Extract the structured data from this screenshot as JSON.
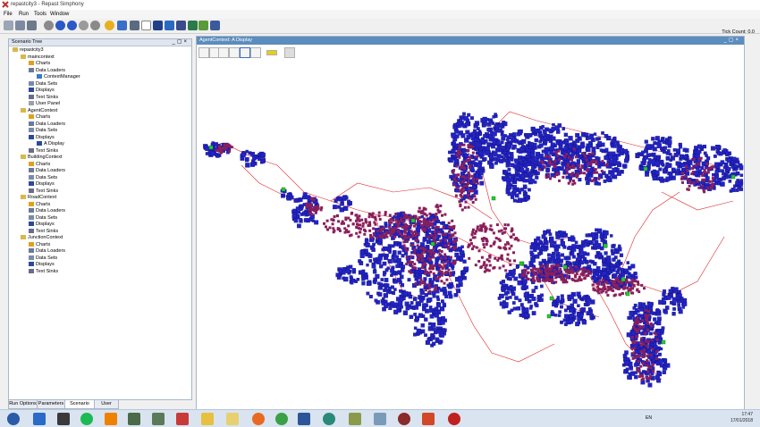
{
  "window": {
    "title": "repastcity3 - Repast Simphony"
  },
  "menu": [
    "File",
    "Run",
    "Tools",
    "Window"
  ],
  "tick_count": "Tick Count: 0.0",
  "left_panel": {
    "title": "Scenario Tree",
    "tree": [
      {
        "label": "repastcity3",
        "level": 0,
        "icon": "folder"
      },
      {
        "label": "maincontext",
        "level": 1,
        "icon": "folder"
      },
      {
        "label": "Charts",
        "level": 2,
        "icon": "chart"
      },
      {
        "label": "Data Loaders",
        "level": 2,
        "icon": "loader"
      },
      {
        "label": "ContextManager",
        "level": 3,
        "icon": "loaderitem"
      },
      {
        "label": "Data Sets",
        "level": 2,
        "icon": "dataset"
      },
      {
        "label": "Displays",
        "level": 2,
        "icon": "display"
      },
      {
        "label": "Text Sinks",
        "level": 2,
        "icon": "sink"
      },
      {
        "label": "User Panel",
        "level": 2,
        "icon": "panel"
      },
      {
        "label": "AgentContext",
        "level": 1,
        "icon": "folder"
      },
      {
        "label": "Charts",
        "level": 2,
        "icon": "chart"
      },
      {
        "label": "Data Loaders",
        "level": 2,
        "icon": "loader"
      },
      {
        "label": "Data Sets",
        "level": 2,
        "icon": "dataset"
      },
      {
        "label": "Displays",
        "level": 2,
        "icon": "display"
      },
      {
        "label": "A Display",
        "level": 3,
        "icon": "display"
      },
      {
        "label": "Text Sinks",
        "level": 2,
        "icon": "sink"
      },
      {
        "label": "BuildingContext",
        "level": 1,
        "icon": "folder"
      },
      {
        "label": "Charts",
        "level": 2,
        "icon": "chart"
      },
      {
        "label": "Data Loaders",
        "level": 2,
        "icon": "loader"
      },
      {
        "label": "Data Sets",
        "level": 2,
        "icon": "dataset"
      },
      {
        "label": "Displays",
        "level": 2,
        "icon": "display"
      },
      {
        "label": "Text Sinks",
        "level": 2,
        "icon": "sink"
      },
      {
        "label": "RoadContext",
        "level": 1,
        "icon": "folder"
      },
      {
        "label": "Charts",
        "level": 2,
        "icon": "chart"
      },
      {
        "label": "Data Loaders",
        "level": 2,
        "icon": "loader"
      },
      {
        "label": "Data Sets",
        "level": 2,
        "icon": "dataset"
      },
      {
        "label": "Displays",
        "level": 2,
        "icon": "display"
      },
      {
        "label": "Text Sinks",
        "level": 2,
        "icon": "sink"
      },
      {
        "label": "JunctionContext",
        "level": 1,
        "icon": "folder"
      },
      {
        "label": "Charts",
        "level": 2,
        "icon": "chart"
      },
      {
        "label": "Data Loaders",
        "level": 2,
        "icon": "loader"
      },
      {
        "label": "Data Sets",
        "level": 2,
        "icon": "dataset"
      },
      {
        "label": "Displays",
        "level": 2,
        "icon": "display"
      },
      {
        "label": "Text Sinks",
        "level": 2,
        "icon": "sink"
      }
    ],
    "tabs": [
      "Run Options",
      "Parameters",
      "Scenario Tree",
      "User Panel"
    ],
    "active_tab": "Scenario Tree"
  },
  "display_panel": {
    "title": "AgentContext: A Display",
    "tools": [
      "save-icon",
      "refresh-icon",
      "home-icon",
      "zoom-icon",
      "zoom-box-icon",
      "pan-icon",
      "info-icon",
      "select-icon"
    ]
  },
  "colors": {
    "building": "#2323c8",
    "agent": "#8a1f5a",
    "junction": "#1fd12a",
    "road": "#e0262a"
  },
  "taskbar": {
    "apps": [
      "start-icon",
      "ie-icon",
      "java-icon",
      "vmware-icon",
      "spotify-icon",
      "vlc-icon",
      "monitor-icon",
      "store-icon",
      "snip-icon",
      "folder-icon",
      "notes-icon",
      "firefox-icon",
      "chrome-icon",
      "word-icon",
      "search-icon",
      "notepad-icon",
      "files-icon",
      "media-icon",
      "powerpoint-icon",
      "repast-icon"
    ],
    "lang": "EN",
    "time": "17:47",
    "date": "17/01/2018"
  }
}
